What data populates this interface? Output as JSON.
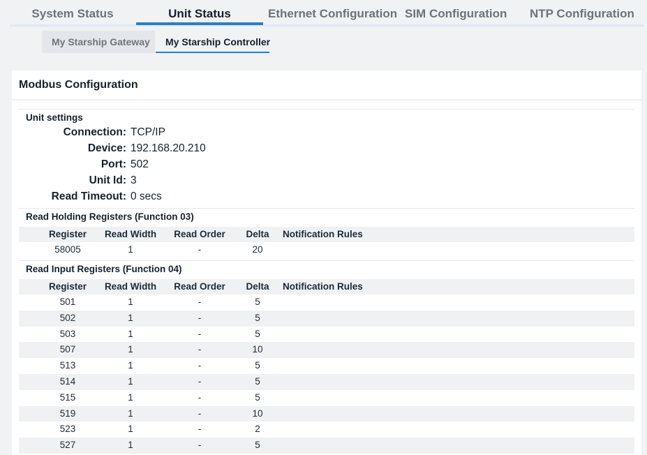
{
  "tabs": [
    {
      "label": "System Status"
    },
    {
      "label": "Unit Status"
    },
    {
      "label": "Ethernet Configuration"
    },
    {
      "label": "SIM Configuration"
    },
    {
      "label": "NTP Configuration"
    }
  ],
  "subtabs": [
    {
      "label": "My Starship Gateway"
    },
    {
      "label": "My Starship Controller"
    }
  ],
  "card": {
    "title": "Modbus Configuration"
  },
  "unit_settings": {
    "title": "Unit settings",
    "fields": [
      {
        "label": "Connection:",
        "value": "TCP/IP"
      },
      {
        "label": "Device:",
        "value": "192.168.20.210"
      },
      {
        "label": "Port:",
        "value": "502"
      },
      {
        "label": "Unit Id:",
        "value": "3"
      },
      {
        "label": "Read Timeout:",
        "value": "0 secs"
      }
    ]
  },
  "table_headers": [
    "Register",
    "Read Width",
    "Read Order",
    "Delta",
    "Notification Rules"
  ],
  "holding": {
    "title": "Read Holding Registers (Function 03)",
    "rows": [
      [
        "58005",
        "1",
        "-",
        "20",
        ""
      ]
    ]
  },
  "input": {
    "title": "Read Input Registers (Function 04)",
    "rows": [
      [
        "501",
        "1",
        "-",
        "5",
        ""
      ],
      [
        "502",
        "1",
        "-",
        "5",
        ""
      ],
      [
        "503",
        "1",
        "-",
        "5",
        ""
      ],
      [
        "507",
        "1",
        "-",
        "10",
        ""
      ],
      [
        "513",
        "1",
        "-",
        "5",
        ""
      ],
      [
        "514",
        "1",
        "-",
        "5",
        ""
      ],
      [
        "515",
        "1",
        "-",
        "5",
        ""
      ],
      [
        "519",
        "1",
        "-",
        "10",
        ""
      ],
      [
        "523",
        "1",
        "-",
        "2",
        ""
      ],
      [
        "527",
        "1",
        "-",
        "5",
        ""
      ]
    ]
  }
}
